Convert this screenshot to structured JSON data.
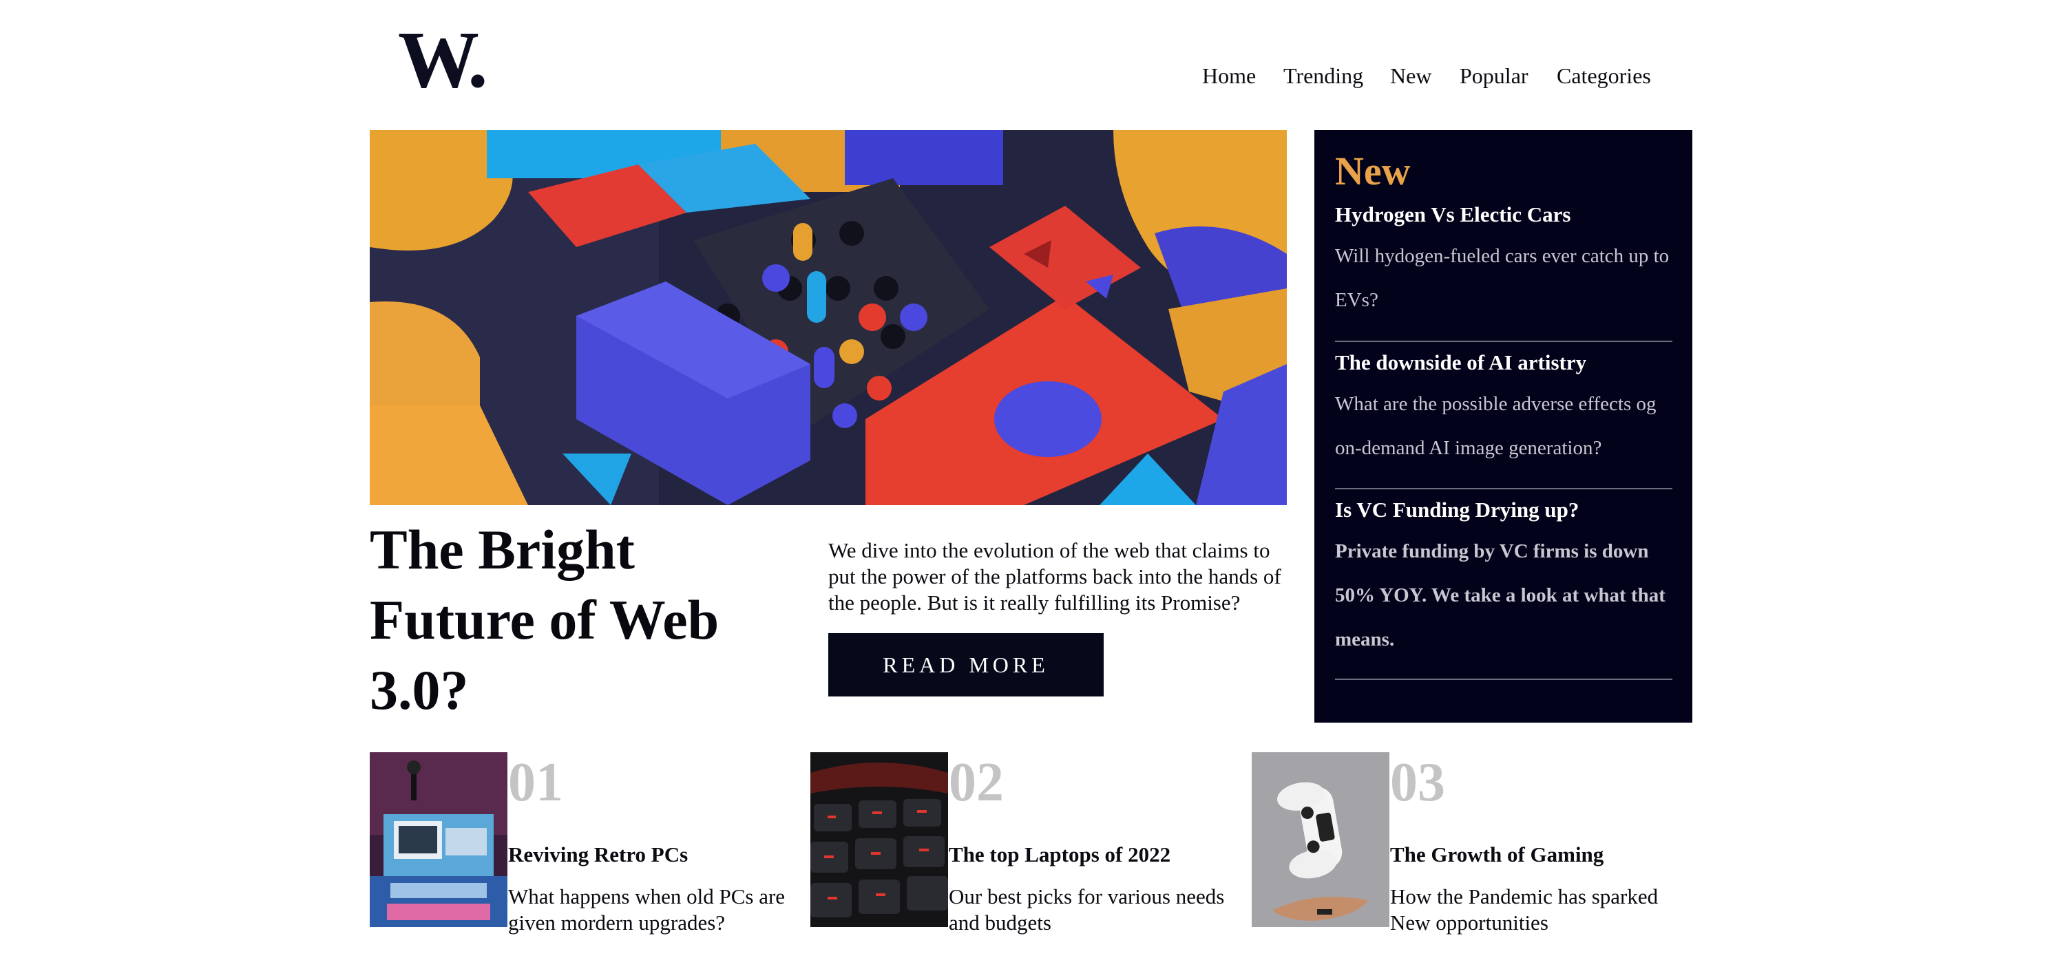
{
  "logo": {
    "text": "W."
  },
  "nav": {
    "items": [
      "Home",
      "Trending",
      "New",
      "Popular",
      "Categories"
    ]
  },
  "hero": {
    "image_icon": "abstract-3d-blocks-image",
    "title": "The Bright Future of Web 3.0?",
    "intro": "We dive into the evolution of the web that claims to put the power of the platforms back into the hands of the people. But is it really fulfilling its Promise?",
    "button_label": "READ MORE"
  },
  "sidebar": {
    "title": "New",
    "items": [
      {
        "title": "Hydrogen Vs Electic Cars",
        "body": "Will hydogen-fueled cars ever catch up to EVs?"
      },
      {
        "title": "The downside of AI artistry",
        "body": "What are the possible adverse effects og on-demand AI image generation?"
      },
      {
        "title": "Is VC Funding Drying up?",
        "body": "Private funding by VC firms is down 50% YOY. We take a look at what that means."
      }
    ]
  },
  "cards": [
    {
      "number": "01",
      "title": "Reviving Retro PCs",
      "description": "What happens when old PCs are given mordern upgrades?",
      "image_icon": "retro-pc-image"
    },
    {
      "number": "02",
      "title": "The top Laptops of 2022",
      "description": "Our best picks for various needs and budgets",
      "image_icon": "laptop-keyboard-image"
    },
    {
      "number": "03",
      "title": "The Growth of Gaming",
      "description": "How the Pandemic has sparked New opportunities",
      "image_icon": "game-controller-image"
    }
  ],
  "colors": {
    "dark_navy": "#02021a",
    "accent_orange": "#e9a24a",
    "muted_gray": "#c4c4c4"
  }
}
